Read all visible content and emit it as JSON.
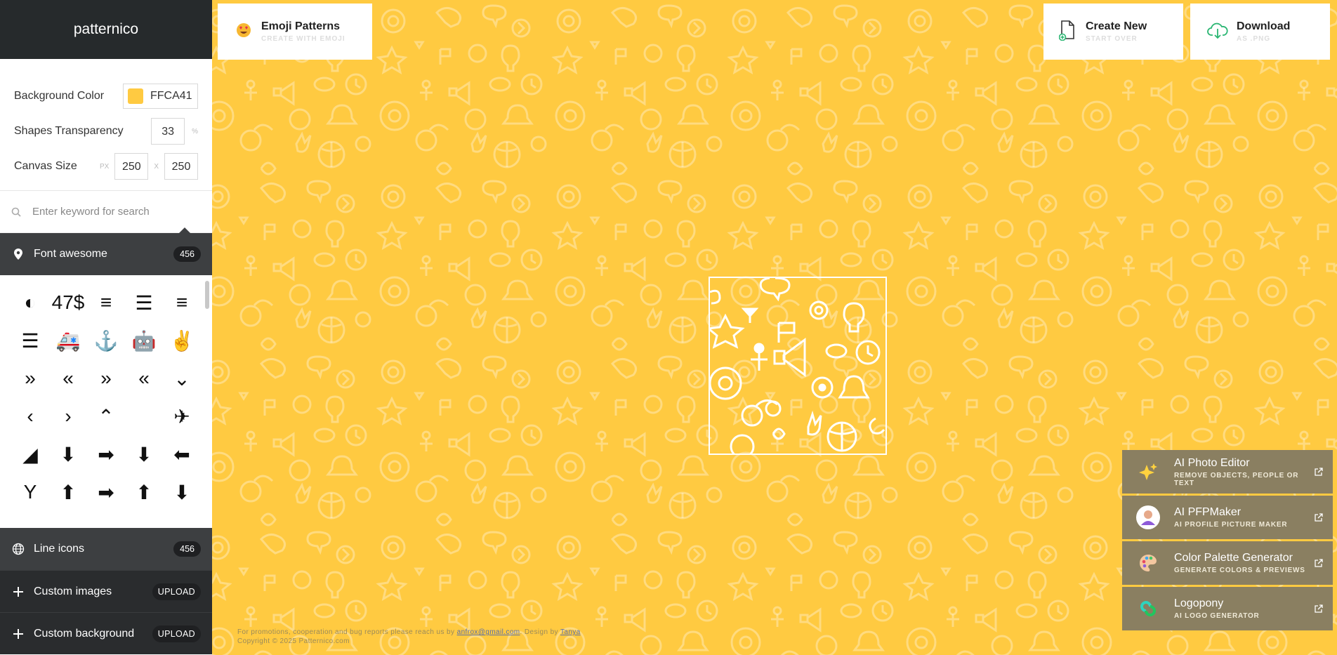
{
  "app": {
    "brand": "patternico"
  },
  "settings": {
    "bg_label": "Background Color",
    "bg_value": "FFCA41",
    "bg_color": "#FFCA41",
    "transparency_label": "Shapes Transparency",
    "transparency_value": "33",
    "transparency_unit": "%",
    "canvas_label": "Canvas Size",
    "canvas_unit": "PX",
    "canvas_w": "250",
    "canvas_sep": "X",
    "canvas_h": "250"
  },
  "search": {
    "placeholder": "Enter keyword for search"
  },
  "sections": {
    "fontawesome": {
      "label": "Font awesome",
      "count": "456"
    },
    "lineicons": {
      "label": "Line icons",
      "count": "456"
    },
    "custom_images": {
      "label": "Custom images",
      "action": "UPLOAD"
    },
    "custom_background": {
      "label": "Custom background",
      "action": "UPLOAD"
    }
  },
  "icon_grid": [
    [
      "◐",
      "47$",
      "≡",
      "☰",
      "≡"
    ],
    [
      "☰",
      "🚑",
      "⚓",
      "🤖",
      "✌"
    ],
    [
      "»",
      "«",
      "»",
      "«",
      "⌄"
    ],
    [
      "‹",
      "›",
      "⌃",
      "",
      "✈"
    ],
    [
      "◢",
      "⬇",
      "➡",
      "⬇",
      "⬅"
    ],
    [
      "Y",
      "⬆",
      "➡",
      "⬆",
      "⬇"
    ]
  ],
  "header": {
    "emoji": {
      "title": "Emoji Patterns",
      "subtitle": "CREATE WITH EMOJI"
    },
    "create": {
      "title": "Create New",
      "subtitle": "START OVER"
    },
    "download": {
      "title": "Download",
      "subtitle": "AS .PNG"
    }
  },
  "promos": [
    {
      "title": "AI Photo Editor",
      "subtitle": "REMOVE OBJECTS, PEOPLE OR TEXT"
    },
    {
      "title": "AI PFPMaker",
      "subtitle": "AI PROFILE PICTURE MAKER"
    },
    {
      "title": "Color Palette Generator",
      "subtitle": "GENERATE COLORS & PREVIEWS"
    },
    {
      "title": "Logopony",
      "subtitle": "AI LOGO GENERATOR"
    }
  ],
  "footer": {
    "line1_prefix": "For promotions, cooperation and bug reports please reach us by",
    "email": "anfrox@gmail.com",
    "design_by": ". Design by",
    "designer": "Tanya",
    "line2": "Copyright © 2025 Patternico.com"
  }
}
